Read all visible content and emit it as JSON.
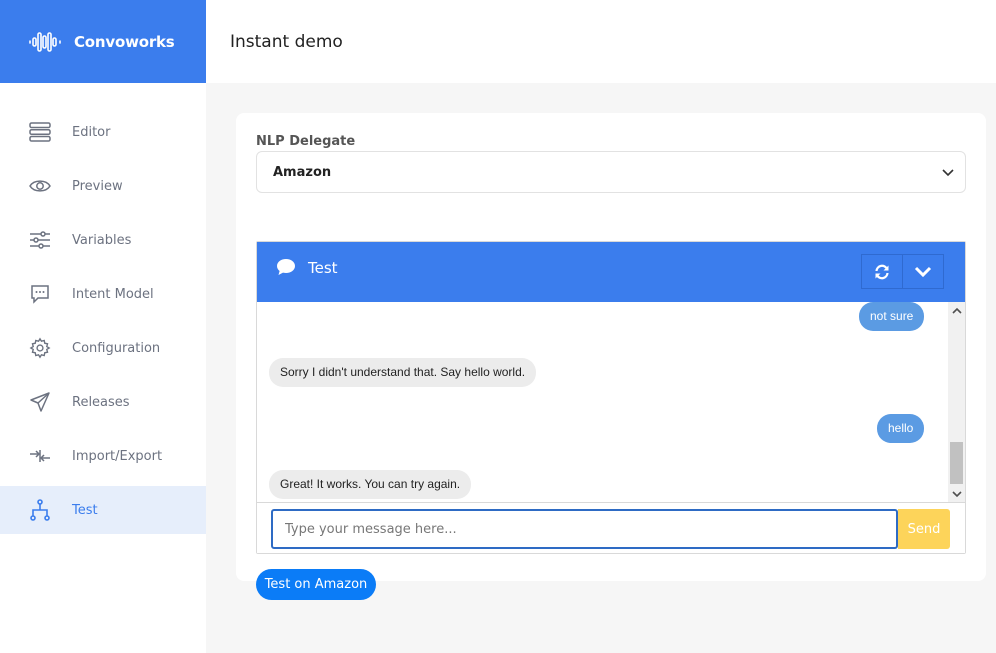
{
  "brand": {
    "name": "Convoworks",
    "icon": "waveform-icon"
  },
  "page": {
    "title": "Instant demo"
  },
  "sidebar": {
    "items": [
      {
        "label": "Editor",
        "icon": "list-icon"
      },
      {
        "label": "Preview",
        "icon": "eye-icon"
      },
      {
        "label": "Variables",
        "icon": "sliders-icon"
      },
      {
        "label": "Intent Model",
        "icon": "chat-dots-icon"
      },
      {
        "label": "Configuration",
        "icon": "gear-icon"
      },
      {
        "label": "Releases",
        "icon": "paper-plane-icon"
      },
      {
        "label": "Import/Export",
        "icon": "import-export-icon"
      },
      {
        "label": "Test",
        "icon": "hierarchy-icon",
        "active": true
      }
    ]
  },
  "nlp": {
    "label": "NLP Delegate",
    "selected": "Amazon"
  },
  "chat": {
    "title": "Test",
    "input_placeholder": "Type your message here...",
    "send_label": "Send",
    "messages": [
      {
        "from": "user",
        "text": "not sure"
      },
      {
        "from": "bot",
        "text": "Sorry I didn't understand that. Say hello world."
      },
      {
        "from": "user",
        "text": "hello"
      },
      {
        "from": "bot",
        "text": "Great! It works. You can try again."
      }
    ]
  },
  "actions": {
    "test_amazon_label": "Test on Amazon"
  },
  "colors": {
    "primary": "#3b7ded",
    "send": "#fdd45a",
    "user_bubble": "#5b9be3",
    "bot_bubble": "#ececec",
    "test_button": "#0b7cf7"
  }
}
